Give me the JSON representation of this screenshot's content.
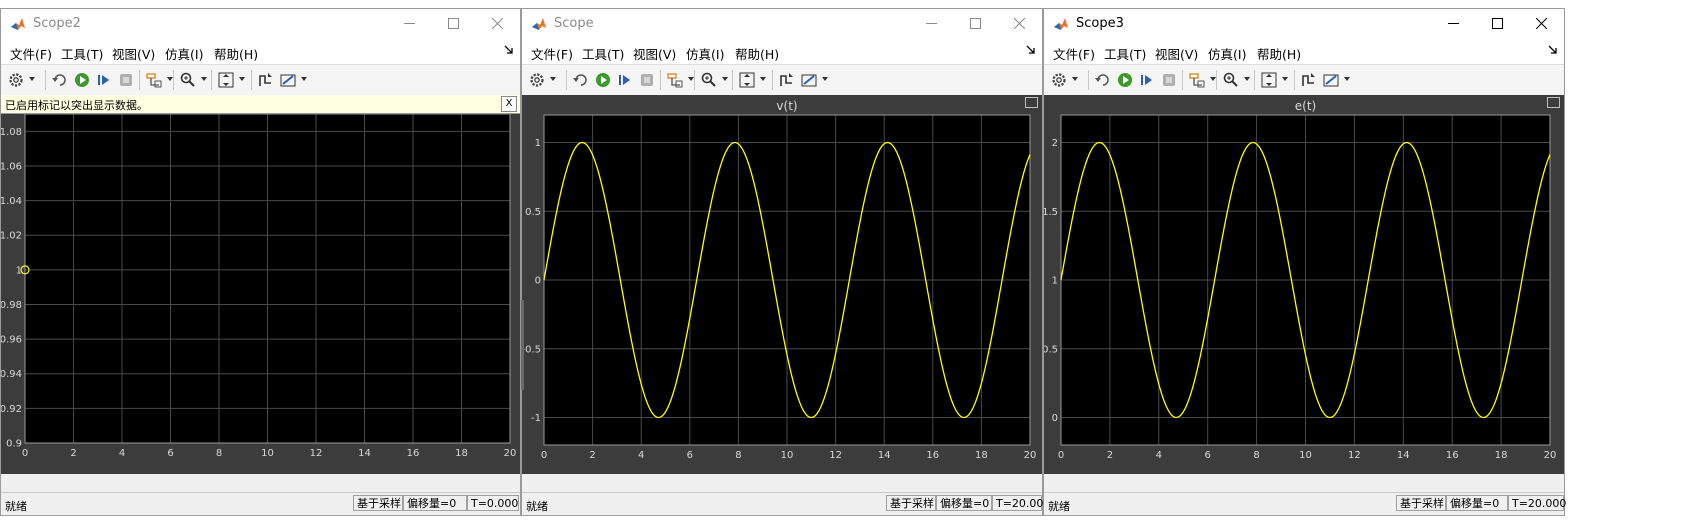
{
  "menus": [
    "文件(F)",
    "工具(T)",
    "视图(V)",
    "仿真(I)",
    "帮助(H)"
  ],
  "colors": {
    "plot_bg": "#000000",
    "frame_bg": "#3c3c3c",
    "grid": "#4a4a4a",
    "trace": "#ffff00",
    "tick_text": "#d9d9d9"
  },
  "toolbar_icons": [
    "gear-icon",
    "step-back-icon",
    "run-icon",
    "step-forward-icon",
    "stop-icon",
    "highlight-signal-icon",
    "zoom-icon",
    "scale-axes-icon",
    "triggers-icon",
    "cursor-measure-icon"
  ],
  "scopes": [
    {
      "title": "Scope2",
      "active": false,
      "info_message": "已启用标记以突出显示数据。",
      "info_close": "X",
      "status": {
        "ready": "就绪",
        "mode": "基于采样",
        "offset": "偏移量=0",
        "time": "T=0.000"
      }
    },
    {
      "title": "Scope",
      "active": false,
      "status": {
        "ready": "就绪",
        "mode": "基于采样",
        "offset": "偏移量=0",
        "time": "T=20.000"
      }
    },
    {
      "title": "Scope3",
      "active": true,
      "status": {
        "ready": "就绪",
        "mode": "基于采样",
        "offset": "偏移量=0",
        "time": "T=20.000"
      }
    }
  ],
  "chart_data": [
    {
      "type": "scatter",
      "title": "",
      "xlim": [
        0,
        20
      ],
      "ylim": [
        0.9,
        1.09
      ],
      "xticks": [
        "0",
        "2",
        "4",
        "6",
        "8",
        "10",
        "12",
        "14",
        "16",
        "18",
        "20"
      ],
      "yticks": [
        "0.9",
        "0.92",
        "0.94",
        "0.96",
        "0.98",
        "1",
        "1.02",
        "1.04",
        "1.06",
        "1.08"
      ],
      "grid": true,
      "series": [
        {
          "x": [
            0
          ],
          "y": [
            1
          ],
          "marker": "circle"
        }
      ]
    },
    {
      "type": "line",
      "title": "v(t)",
      "xlim": [
        0,
        20
      ],
      "ylim": [
        -1.2,
        1.2
      ],
      "xticks": [
        "0",
        "2",
        "4",
        "6",
        "8",
        "10",
        "12",
        "14",
        "16",
        "18",
        "20"
      ],
      "yticks": [
        "-1",
        "-0.5",
        "0",
        "0.5",
        "1"
      ],
      "grid": true,
      "series": [
        {
          "function": "sin(t)",
          "offset": 0,
          "amplitude": 1,
          "x_range": [
            0,
            20
          ]
        }
      ]
    },
    {
      "type": "line",
      "title": "e(t)",
      "xlim": [
        0,
        20
      ],
      "ylim": [
        -0.2,
        2.2
      ],
      "xticks": [
        "0",
        "2",
        "4",
        "6",
        "8",
        "10",
        "12",
        "14",
        "16",
        "18",
        "20"
      ],
      "yticks": [
        "0",
        "0.5",
        "1",
        "1.5",
        "2"
      ],
      "grid": true,
      "series": [
        {
          "function": "1+sin(t)",
          "offset": 1,
          "amplitude": 1,
          "x_range": [
            0,
            20
          ]
        }
      ]
    }
  ]
}
